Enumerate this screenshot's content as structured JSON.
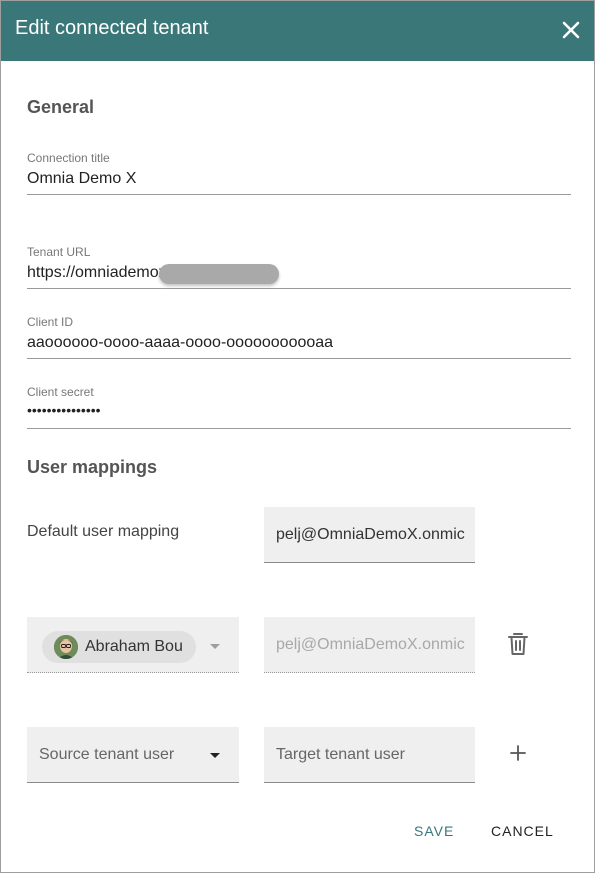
{
  "dialog": {
    "title": "Edit connected tenant",
    "header_color": "#3a7778",
    "close_icon": "close-icon"
  },
  "general": {
    "heading": "General",
    "connection_title": {
      "label": "Connection title",
      "value": "Omnia Demo X"
    },
    "tenant_url": {
      "label": "Tenant URL",
      "value": "https://omniademox."
    },
    "client_id": {
      "label": "Client ID",
      "value": "aaoooooo-oooo-aaaa-oooo-ooooooooooaa"
    },
    "client_secret": {
      "label": "Client secret",
      "value": "•••••••••••••••"
    }
  },
  "user_mappings": {
    "heading": "User mappings",
    "default": {
      "label": "Default user mapping",
      "value": "pelj@OmniaDemoX.onmic"
    },
    "mapping_row": {
      "source_user": "Abraham Bou",
      "target_user": "pelj@OmniaDemoX.onmic",
      "delete_icon": "trash-icon"
    },
    "new_row": {
      "source_placeholder": "Source tenant user",
      "target_placeholder": "Target tenant user",
      "add_icon": "plus-icon"
    }
  },
  "actions": {
    "save": "SAVE",
    "cancel": "CANCEL",
    "save_color": "#3a7778"
  }
}
